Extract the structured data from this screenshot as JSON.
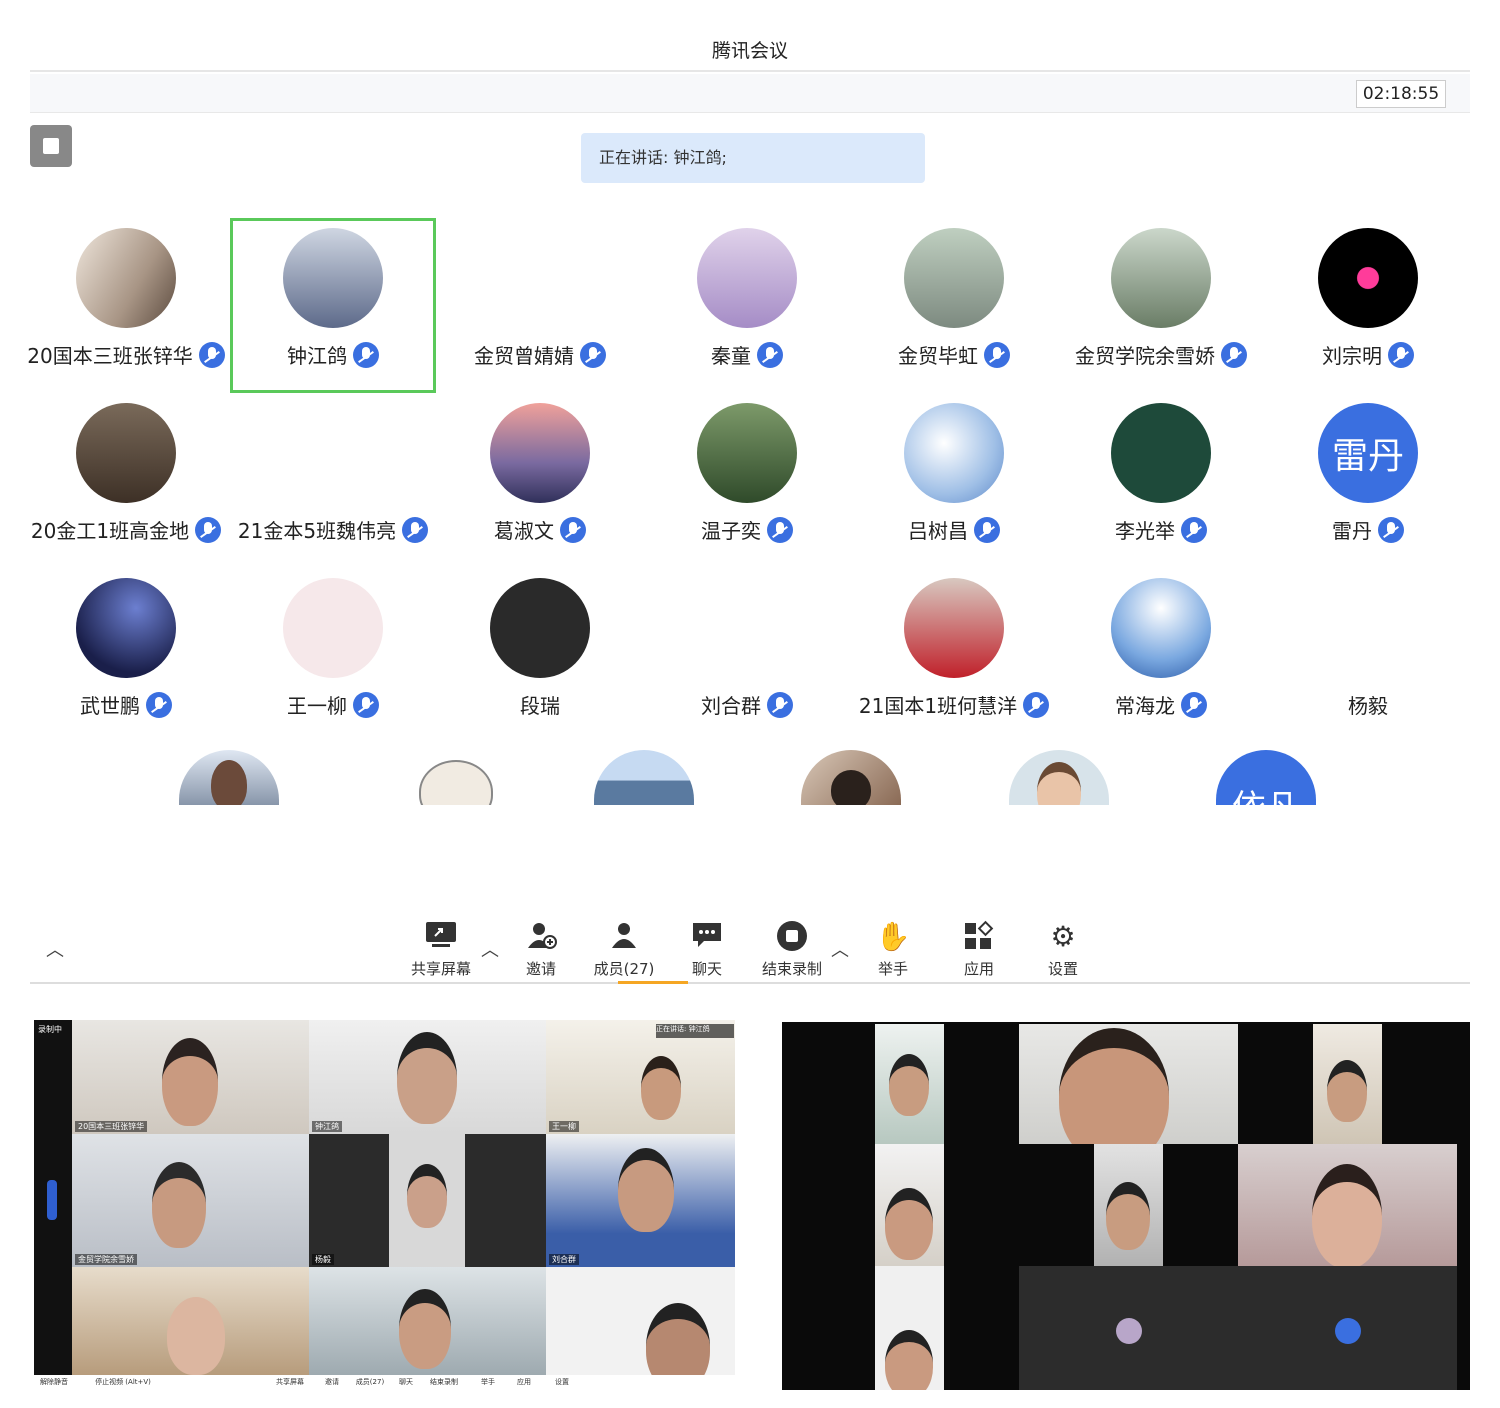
{
  "window": {
    "title": "腾讯会议",
    "timer": "02:18:55"
  },
  "speaking": {
    "text": "正在讲话: 钟江鸽;"
  },
  "participants": [
    {
      "name": "20国本三班张锌华"
    },
    {
      "name": "钟江鸽"
    },
    {
      "name": "金贸曾婧婧"
    },
    {
      "name": "秦童"
    },
    {
      "name": "金贸毕虹"
    },
    {
      "name": "金贸学院余雪娇"
    },
    {
      "name": "刘宗明"
    },
    {
      "name": "20金工1班高金地"
    },
    {
      "name": "21金本5班魏伟亮"
    },
    {
      "name": "葛淑文"
    },
    {
      "name": "温子奕"
    },
    {
      "name": "吕树昌"
    },
    {
      "name": "李光举"
    },
    {
      "name": "雷丹",
      "avatar_text": "雷丹"
    },
    {
      "name": "武世鹏"
    },
    {
      "name": "王一柳"
    },
    {
      "name": "段瑞"
    },
    {
      "name": "刘合群"
    },
    {
      "name": "21国本1班何慧洋"
    },
    {
      "name": "常海龙"
    },
    {
      "name": "杨毅"
    }
  ],
  "partial_row": {
    "last_avatar_text": "依凡"
  },
  "toolbar": {
    "share": "共享屏幕",
    "invite": "邀请",
    "members": "成员(27)",
    "chat": "聊天",
    "record": "结束录制",
    "hand": "举手",
    "apps": "应用",
    "settings": "设置"
  },
  "left_shot": {
    "labels": [
      "20国本三班张锌华",
      "钟江鸽",
      "王一柳",
      "金贸学院余雪娇",
      "杨毅",
      "刘合群"
    ],
    "status": "录制中",
    "speaking": "正在讲话: 钟江鸽",
    "mini_toolbar": [
      "解除静音",
      "停止视频 (Alt+V)",
      "共享屏幕",
      "邀请",
      "成员(27)",
      "聊天",
      "结束录制",
      "举手",
      "应用",
      "设置"
    ]
  },
  "colors": {
    "accent_blue": "#3a6fe0",
    "active_border": "#5ac95a",
    "speaking_bg": "#dbe9fb"
  }
}
